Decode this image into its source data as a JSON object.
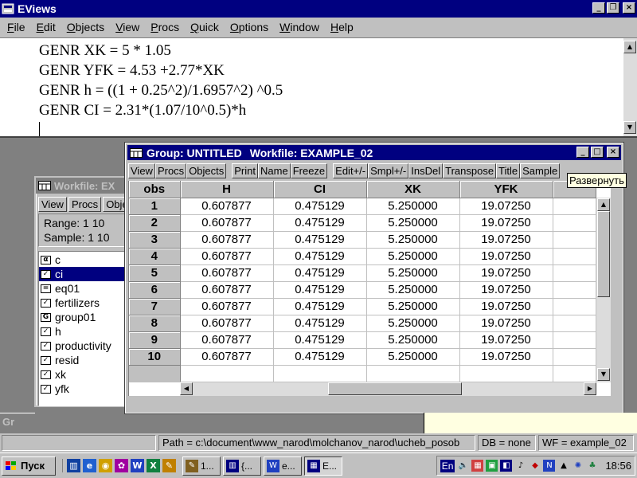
{
  "app": {
    "title": "EViews"
  },
  "menu": [
    "File",
    "Edit",
    "Objects",
    "View",
    "Procs",
    "Quick",
    "Options",
    "Window",
    "Help"
  ],
  "command": {
    "lines": [
      "GENR XK = 5 * 1.05",
      "GENR YFK = 4.53 +2.77*XK",
      "GENR h = ((1 + 0.25^2)/1.6957^2) ^0.5",
      "GENR CI = 2.31*(1.07/10^0.5)*h"
    ]
  },
  "workfile": {
    "title": "Workfile: EX",
    "toolbar": [
      "View",
      "Procs",
      "Obje"
    ],
    "range": "Range:   1 10",
    "sample": "Sample:  1 10",
    "objects": [
      {
        "icon": "alpha-icon",
        "glyph": "α",
        "name": "c",
        "selected": false
      },
      {
        "icon": "series-icon",
        "glyph": "✓",
        "name": "ci",
        "selected": true
      },
      {
        "icon": "equation-icon",
        "glyph": "=",
        "name": "eq01",
        "selected": false
      },
      {
        "icon": "series-icon",
        "glyph": "✓",
        "name": "fertilizers",
        "selected": false
      },
      {
        "icon": "group-icon",
        "glyph": "G",
        "name": "group01",
        "selected": false
      },
      {
        "icon": "series-icon",
        "glyph": "✓",
        "name": "h",
        "selected": false
      },
      {
        "icon": "series-icon",
        "glyph": "✓",
        "name": "productivity",
        "selected": false
      },
      {
        "icon": "series-icon",
        "glyph": "✓",
        "name": "resid",
        "selected": false
      },
      {
        "icon": "series-icon",
        "glyph": "✓",
        "name": "xk",
        "selected": false
      },
      {
        "icon": "series-icon",
        "glyph": "✓",
        "name": "yfk",
        "selected": false
      }
    ]
  },
  "group": {
    "title": "Group: UNTITLED",
    "workfile": "Workfile: EXAMPLE_02",
    "toolbar": [
      "View",
      "Procs",
      "Objects",
      "|",
      "Print",
      "Name",
      "Freeze",
      "|",
      "Edit+/-",
      "Smpl+/-",
      "InsDel",
      "Transpose",
      "Title",
      "Sample"
    ],
    "columns": [
      "obs",
      "H",
      "CI",
      "XK",
      "YFK"
    ],
    "rows": [
      [
        "1",
        "0.607877",
        "0.475129",
        "5.250000",
        "19.07250"
      ],
      [
        "2",
        "0.607877",
        "0.475129",
        "5.250000",
        "19.07250"
      ],
      [
        "3",
        "0.607877",
        "0.475129",
        "5.250000",
        "19.07250"
      ],
      [
        "4",
        "0.607877",
        "0.475129",
        "5.250000",
        "19.07250"
      ],
      [
        "5",
        "0.607877",
        "0.475129",
        "5.250000",
        "19.07250"
      ],
      [
        "6",
        "0.607877",
        "0.475129",
        "5.250000",
        "19.07250"
      ],
      [
        "7",
        "0.607877",
        "0.475129",
        "5.250000",
        "19.07250"
      ],
      [
        "8",
        "0.607877",
        "0.475129",
        "5.250000",
        "19.07250"
      ],
      [
        "9",
        "0.607877",
        "0.475129",
        "5.250000",
        "19.07250"
      ],
      [
        "10",
        "0.607877",
        "0.475129",
        "5.250000",
        "19.07250"
      ]
    ]
  },
  "tooltip": "Развернуть",
  "status": {
    "path": "Path = c:\\document\\www_narod\\molchanov_narod\\ucheb_posob",
    "db": "DB = none",
    "wf": "WF = example_02"
  },
  "taskbar": {
    "start": "Пуск",
    "tasks": [
      "1...",
      "{...",
      "e...",
      "E..."
    ],
    "lang": "En",
    "clock": "18:56"
  },
  "minimized": "Gr",
  "colors": {
    "titlebar_active": "#000080",
    "titlebar_inactive": "#808080",
    "face": "#c0c0c0",
    "tooltip_bg": "#ffffe1"
  }
}
